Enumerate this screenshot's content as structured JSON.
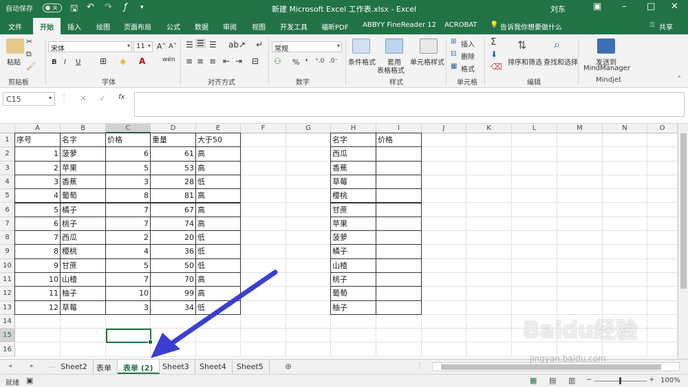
{
  "titlebar": {
    "autosave_label": "自动保存",
    "autosave_state": "关",
    "title": "新建 Microsoft Excel 工作表.xlsx  -  Excel",
    "user": "刘东",
    "colors": {
      "brand": "#217346"
    }
  },
  "ribbon_tabs": [
    "文件",
    "开始",
    "插入",
    "绘图",
    "页面布局",
    "公式",
    "数据",
    "审阅",
    "视图",
    "开发工具",
    "福昕PDF",
    "ABBYY FineReader 12",
    "ACROBAT"
  ],
  "tell_me": "告诉我你想要做什么",
  "share": "共享",
  "ribbon": {
    "clipboard": {
      "paste": "粘贴",
      "label": "剪贴板"
    },
    "font": {
      "name": "宋体",
      "size": "11",
      "label": "字体",
      "bold": "B",
      "italic": "I",
      "underline": "U"
    },
    "alignment": {
      "label": "对齐方式"
    },
    "number": {
      "format": "常规",
      "label": "数字",
      "percent": "%"
    },
    "styles": {
      "conditional": "条件格式",
      "table_1": "套用",
      "table_2": "表格格式",
      "cell_styles": "单元格样式",
      "label": "样式"
    },
    "cells": {
      "insert": "插入",
      "delete": "删除",
      "format": "格式",
      "label": "单元格"
    },
    "editing": {
      "sort": "排序和筛选",
      "find": "查找和选择",
      "label": "编辑"
    },
    "mindjet": {
      "send_1": "发送到",
      "send_2": "MindManager",
      "label": "Mindjet"
    }
  },
  "formula_bar": {
    "name_box": "C15",
    "fx": "fx"
  },
  "grid": {
    "columns": [
      "A",
      "B",
      "C",
      "D",
      "E",
      "F",
      "G",
      "H",
      "I",
      "J",
      "K",
      "L",
      "M",
      "N",
      "O"
    ],
    "rows": [
      "1",
      "2",
      "3",
      "4",
      "5",
      "6",
      "7",
      "8",
      "9",
      "10",
      "11",
      "12",
      "13",
      "14",
      "15",
      "16"
    ],
    "table1_headers": [
      "序号",
      "名字",
      "价格",
      "重量",
      "大于50"
    ],
    "table1_rows": [
      [
        "1",
        "菠萝",
        "6",
        "61",
        "高"
      ],
      [
        "2",
        "苹果",
        "5",
        "53",
        "高"
      ],
      [
        "3",
        "香蕉",
        "3",
        "28",
        "低"
      ],
      [
        "4",
        "葡萄",
        "8",
        "81",
        "高"
      ],
      [
        "5",
        "橘子",
        "7",
        "67",
        "高"
      ],
      [
        "6",
        "桃子",
        "7",
        "74",
        "高"
      ],
      [
        "7",
        "西瓜",
        "2",
        "20",
        "低"
      ],
      [
        "8",
        "樱桃",
        "4",
        "36",
        "低"
      ],
      [
        "9",
        "甘蔗",
        "5",
        "50",
        "低"
      ],
      [
        "10",
        "山楂",
        "7",
        "70",
        "高"
      ],
      [
        "11",
        "柚子",
        "10",
        "99",
        "高"
      ],
      [
        "12",
        "草莓",
        "3",
        "34",
        "低"
      ]
    ],
    "table2_headers": [
      "名字",
      "价格"
    ],
    "table2_rows": [
      "西瓜",
      "香蕉",
      "草莓",
      "樱桃",
      "甘蔗",
      "苹果",
      "菠萝",
      "橘子",
      "山楂",
      "桃子",
      "葡萄",
      "柚子"
    ]
  },
  "sheets": [
    "Sheet2",
    "表单",
    "表单 (2)",
    "Sheet3",
    "Sheet4",
    "Sheet5"
  ],
  "active_sheet": "表单 (2)",
  "status": {
    "ready": "就绪",
    "zoom": "100%"
  },
  "watermark": {
    "brand": "Baidu经验",
    "url": "jingyan.baidu.com"
  }
}
